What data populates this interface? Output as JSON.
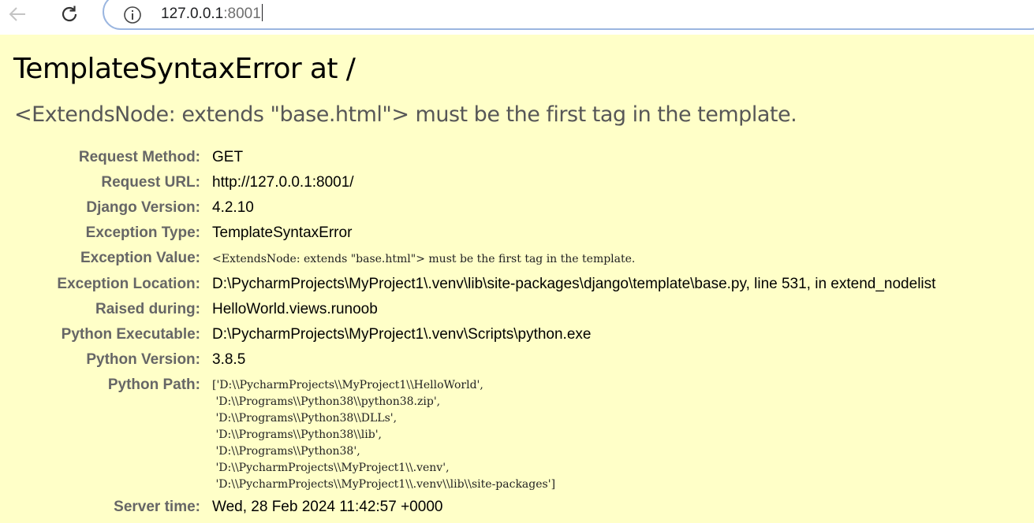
{
  "browser": {
    "url_host": "127.0.0.1",
    "url_port": ":8001"
  },
  "page": {
    "title": "TemplateSyntaxError at /",
    "summary": "<ExtendsNode: extends \"base.html\"> must be the first tag in the template."
  },
  "meta": [
    {
      "label": "Request Method:",
      "value": "GET"
    },
    {
      "label": "Request URL:",
      "value": "http://127.0.0.1:8001/"
    },
    {
      "label": "Django Version:",
      "value": "4.2.10"
    },
    {
      "label": "Exception Type:",
      "value": "TemplateSyntaxError"
    },
    {
      "label": "Exception Value:",
      "value": "<ExtendsNode: extends \"base.html\"> must be the first tag in the template."
    },
    {
      "label": "Exception Location:",
      "value": "D:\\PycharmProjects\\MyProject1\\.venv\\lib\\site-packages\\django\\template\\base.py, line 531, in extend_nodelist"
    },
    {
      "label": "Raised during:",
      "value": "HelloWorld.views.runoob"
    },
    {
      "label": "Python Executable:",
      "value": "D:\\PycharmProjects\\MyProject1\\.venv\\Scripts\\python.exe"
    },
    {
      "label": "Python Version:",
      "value": "3.8.5"
    },
    {
      "label": "Python Path:",
      "value": "['D:\\\\PycharmProjects\\\\MyProject1\\\\HelloWorld',\n 'D:\\\\Programs\\\\Python38\\\\python38.zip',\n 'D:\\\\Programs\\\\Python38\\\\DLLs',\n 'D:\\\\Programs\\\\Python38\\\\lib',\n 'D:\\\\Programs\\\\Python38',\n 'D:\\\\PycharmProjects\\\\MyProject1\\\\.venv',\n 'D:\\\\PycharmProjects\\\\MyProject1\\\\.venv\\\\lib\\\\site-packages']"
    },
    {
      "label": "Server time:",
      "value": "Wed, 28 Feb 2024 11:42:57 +0000"
    }
  ]
}
